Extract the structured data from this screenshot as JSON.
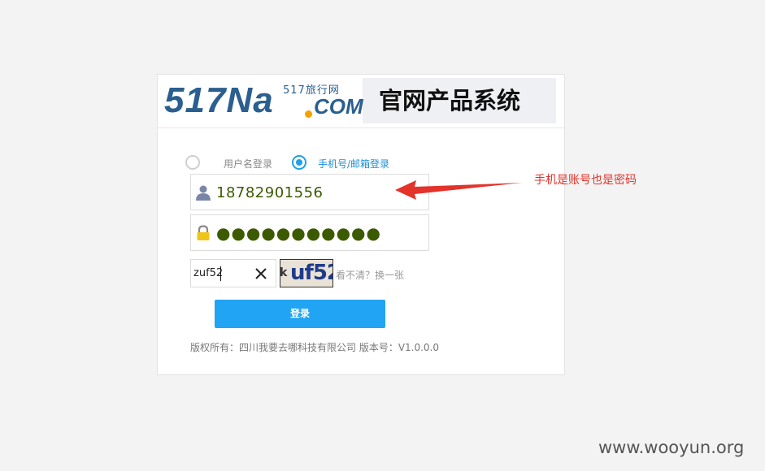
{
  "header": {
    "logo_main": "517Na",
    "logo_com": "COM",
    "logo_sub": "517旅行网",
    "title": "官网产品系统"
  },
  "login_modes": [
    {
      "label": "用户名登录",
      "selected": false
    },
    {
      "label": "手机号/邮箱登录",
      "selected": true
    }
  ],
  "phone_field": {
    "value": "18782901556",
    "icon": "user-icon"
  },
  "password_field": {
    "masked_value": "●●●●●●●●●●●",
    "icon": "lock-icon"
  },
  "captcha": {
    "input_value": "zuf52",
    "image_text": "uf52",
    "image_prefix": "k",
    "refresh_text": "看不清？换一张"
  },
  "login_button": {
    "label": "登录"
  },
  "footer": {
    "text": "版权所有：四川我要去哪科技有限公司 版本号：V1.0.0.0"
  },
  "annotation": {
    "text": "手机是账号也是密码",
    "color": "#e3332b"
  },
  "watermark": "www.wooyun.org",
  "colors": {
    "accent": "#20a4f3",
    "brand": "#2a5f8f",
    "logo_dot": "#f4a100",
    "input_text": "#3c5a00"
  }
}
